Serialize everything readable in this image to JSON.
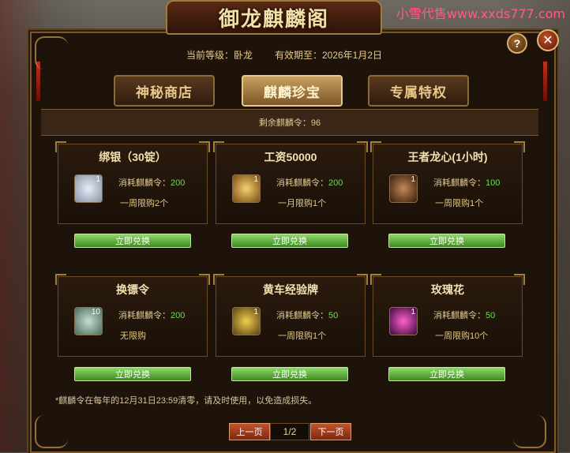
{
  "watermark": "小雪代售www.xxds777.com",
  "header": {
    "title": "御龙麒麟阁",
    "level_text": "当前等级：卧龙",
    "expiry_text": "有效期至：2026年1月2日",
    "help": "?",
    "close": "✕"
  },
  "tabs": [
    {
      "label": "神秘商店",
      "active": false
    },
    {
      "label": "麒麟珍宝",
      "active": true
    },
    {
      "label": "专属特权",
      "active": false
    }
  ],
  "remaining_text": "剩余麒麟令：96",
  "items": [
    {
      "name": "绑银（30锭）",
      "count": "1",
      "cost_label": "消耗麒麟令：",
      "cost": "200",
      "limit": "一周限购2个",
      "button": "立即兑换",
      "icon": "silver-ingot-icon",
      "icon_color": "#b0b8c8"
    },
    {
      "name": "工资50000",
      "count": "1",
      "cost_label": "消耗麒麟令：",
      "cost": "200",
      "limit": "一月限购1个",
      "button": "立即兑换",
      "icon": "gold-scroll-icon",
      "icon_color": "#d8a23c"
    },
    {
      "name": "王者龙心(1小时)",
      "count": "1",
      "cost_label": "消耗麒麟令：",
      "cost": "100",
      "limit": "一周限购1个",
      "button": "立即兑换",
      "icon": "dragon-head-icon",
      "icon_color": "#a8683a"
    },
    {
      "name": "换镖令",
      "count": "10",
      "cost_label": "消耗麒麟令：",
      "cost": "200",
      "limit": "无限购",
      "button": "立即兑换",
      "icon": "jade-token-icon",
      "icon_color": "#8ab89c"
    },
    {
      "name": "黄车经验牌",
      "count": "1",
      "cost_label": "消耗麒麟令：",
      "cost": "50",
      "limit": "一周限购1个",
      "button": "立即兑换",
      "icon": "golden-cart-icon",
      "icon_color": "#d8b030"
    },
    {
      "name": "玫瑰花",
      "count": "1",
      "cost_label": "消耗麒麟令：",
      "cost": "50",
      "limit": "一周限购10个",
      "button": "立即兑换",
      "icon": "rose-icon",
      "icon_color": "#c02ac8"
    }
  ],
  "note": "*麒麟令在每年的12月31日23:59清零，请及时使用，以免造成损失。",
  "pager": {
    "prev": "上一页",
    "page": "1/2",
    "next": "下一页"
  }
}
